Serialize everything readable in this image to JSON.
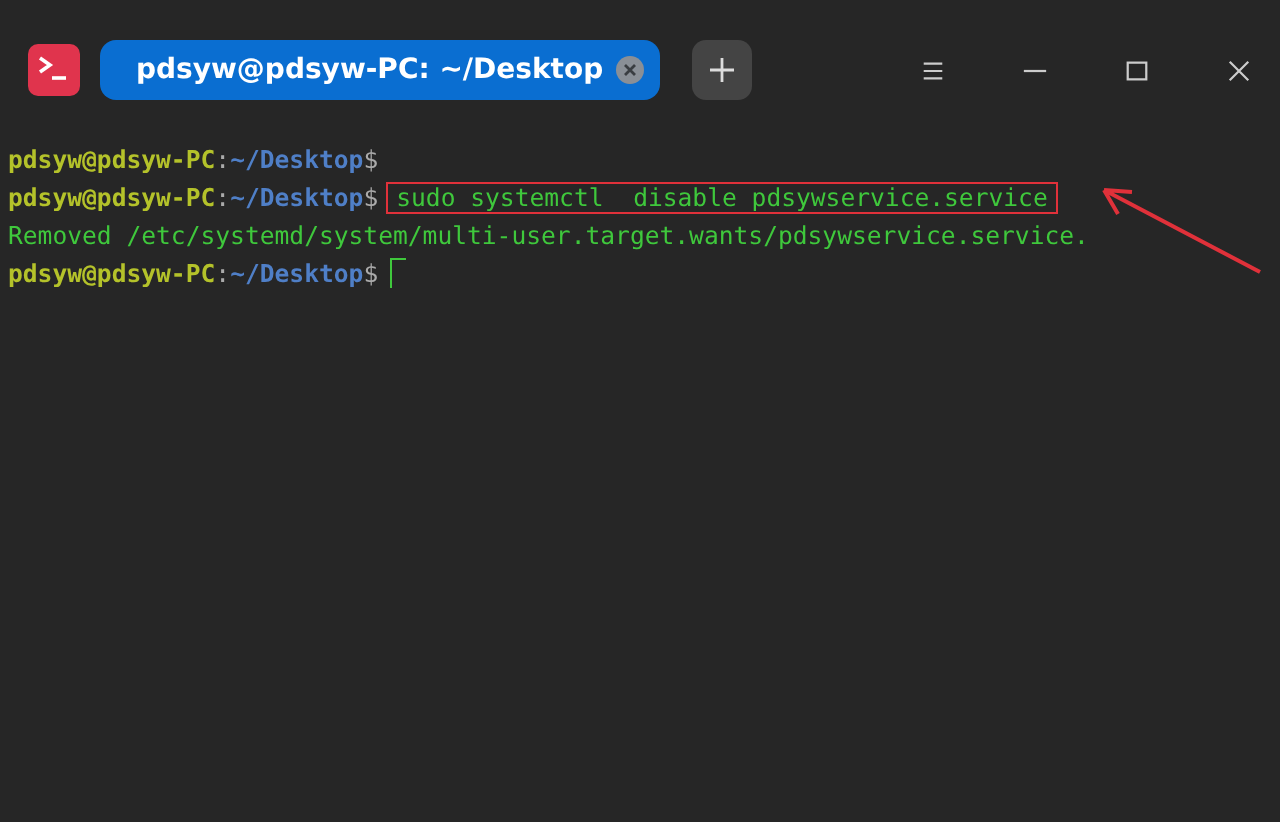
{
  "title_bar": {
    "tabs": [
      {
        "label": "pdsyw@pdsyw-PC: ~/Desktop",
        "selected": true
      }
    ]
  },
  "terminal": {
    "lines": [
      {
        "kind": "prompt",
        "host": "pdsyw@pdsyw-PC",
        "separator": ":",
        "path": "~/Desktop",
        "symbol": "$"
      },
      {
        "kind": "prompt",
        "host": "pdsyw@pdsyw-PC",
        "separator": ":",
        "path": "~/Desktop",
        "symbol": "$",
        "command": "sudo systemctl  disable pdsywservice.service",
        "highlighted": true
      },
      {
        "kind": "output",
        "text": "Removed /etc/systemd/system/multi-user.target.wants/pdsywservice.service."
      },
      {
        "kind": "prompt",
        "host": "pdsyw@pdsyw-PC",
        "separator": ":",
        "path": "~/Desktop",
        "symbol": "$",
        "cursor": true
      }
    ]
  }
}
